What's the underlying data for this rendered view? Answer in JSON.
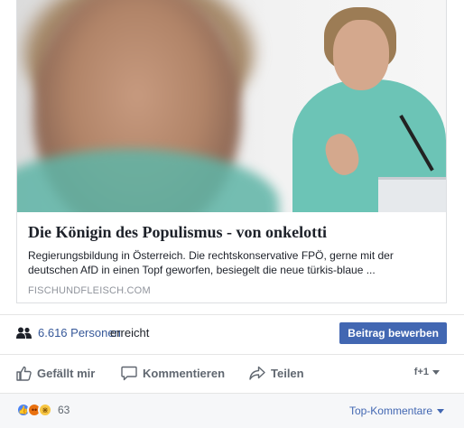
{
  "link_card": {
    "title": "Die Königin des Populismus - von onkelotti",
    "description": "Regierungsbildung in Österreich. Die rechtskonservative FPÖ, gerne mit der deutschen AfD in einen Topf geworfen, besiegelt die neue türkis-blaue ...",
    "domain": "FISCHUNDFLEISCH.COM"
  },
  "reach": {
    "count": "6.616 Personen",
    "label": "erreicht",
    "boost_label": "Beitrag bewerben"
  },
  "actions": {
    "like": "Gefällt mir",
    "comment": "Kommentieren",
    "share": "Teilen"
  },
  "audience": {
    "icon": "friends-of-friends-icon",
    "symbol": "f+1"
  },
  "footer": {
    "reaction_icons": [
      "like-icon",
      "angry-icon",
      "haha-icon"
    ],
    "reaction_count": "63",
    "sort_label": "Top-Kommentare"
  },
  "colors": {
    "link": "#365899",
    "button": "#4267b2",
    "muted": "#606770"
  }
}
